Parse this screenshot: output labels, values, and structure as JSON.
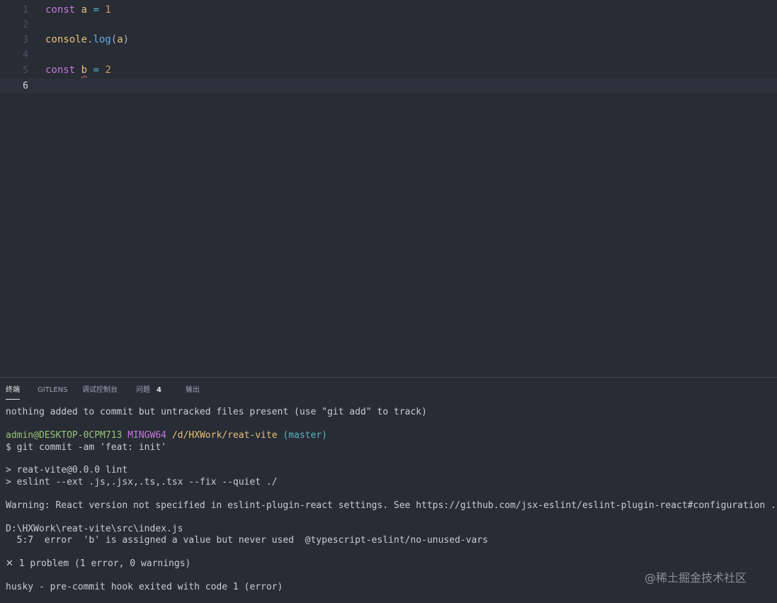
{
  "editor": {
    "lines": [
      {
        "num": "1",
        "kw": "const",
        "name": "a",
        "op": "=",
        "value": "1"
      },
      {
        "num": "2"
      },
      {
        "num": "3",
        "obj": "console",
        "dot": ".",
        "method": "log",
        "open": "(",
        "arg": "a",
        "close": ")"
      },
      {
        "num": "4"
      },
      {
        "num": "5",
        "kw": "const",
        "name": "b",
        "op": "=",
        "value": "2"
      },
      {
        "num": "6"
      }
    ]
  },
  "panel": {
    "tabs": [
      {
        "label": "终端"
      },
      {
        "label": "GITLENS"
      },
      {
        "label": "调试控制台"
      },
      {
        "label": "问题",
        "badge": "4"
      },
      {
        "label": "输出"
      }
    ]
  },
  "terminal": {
    "line1": "nothing added to commit but untracked files present (use \"git add\" to track)",
    "prompt_user": "admin@DESKTOP-0CPM713",
    "prompt_msys": "MINGW64",
    "prompt_path": "/d/HXWork/reat-vite",
    "prompt_branch": "(master)",
    "command": "$ git commit -am 'feat: init'",
    "lint1": "> reat-vite@0.0.0 lint",
    "lint2": "> eslint --ext .js,.jsx,.ts,.tsx --fix --quiet ./",
    "warning": "Warning: React version not specified in eslint-plugin-react settings. See https://github.com/jsx-eslint/eslint-plugin-react#configuration .",
    "file": "D:\\HXWork\\reat-vite\\src\\index.js",
    "error": "  5:7  error  'b' is assigned a value but never used  @typescript-eslint/no-unused-vars",
    "problem_icon": "✕",
    "problem": "1 problem (1 error, 0 warnings)",
    "husky": "husky - pre-commit hook exited with code 1 (error)"
  },
  "watermark": "@稀土掘金技术社区"
}
